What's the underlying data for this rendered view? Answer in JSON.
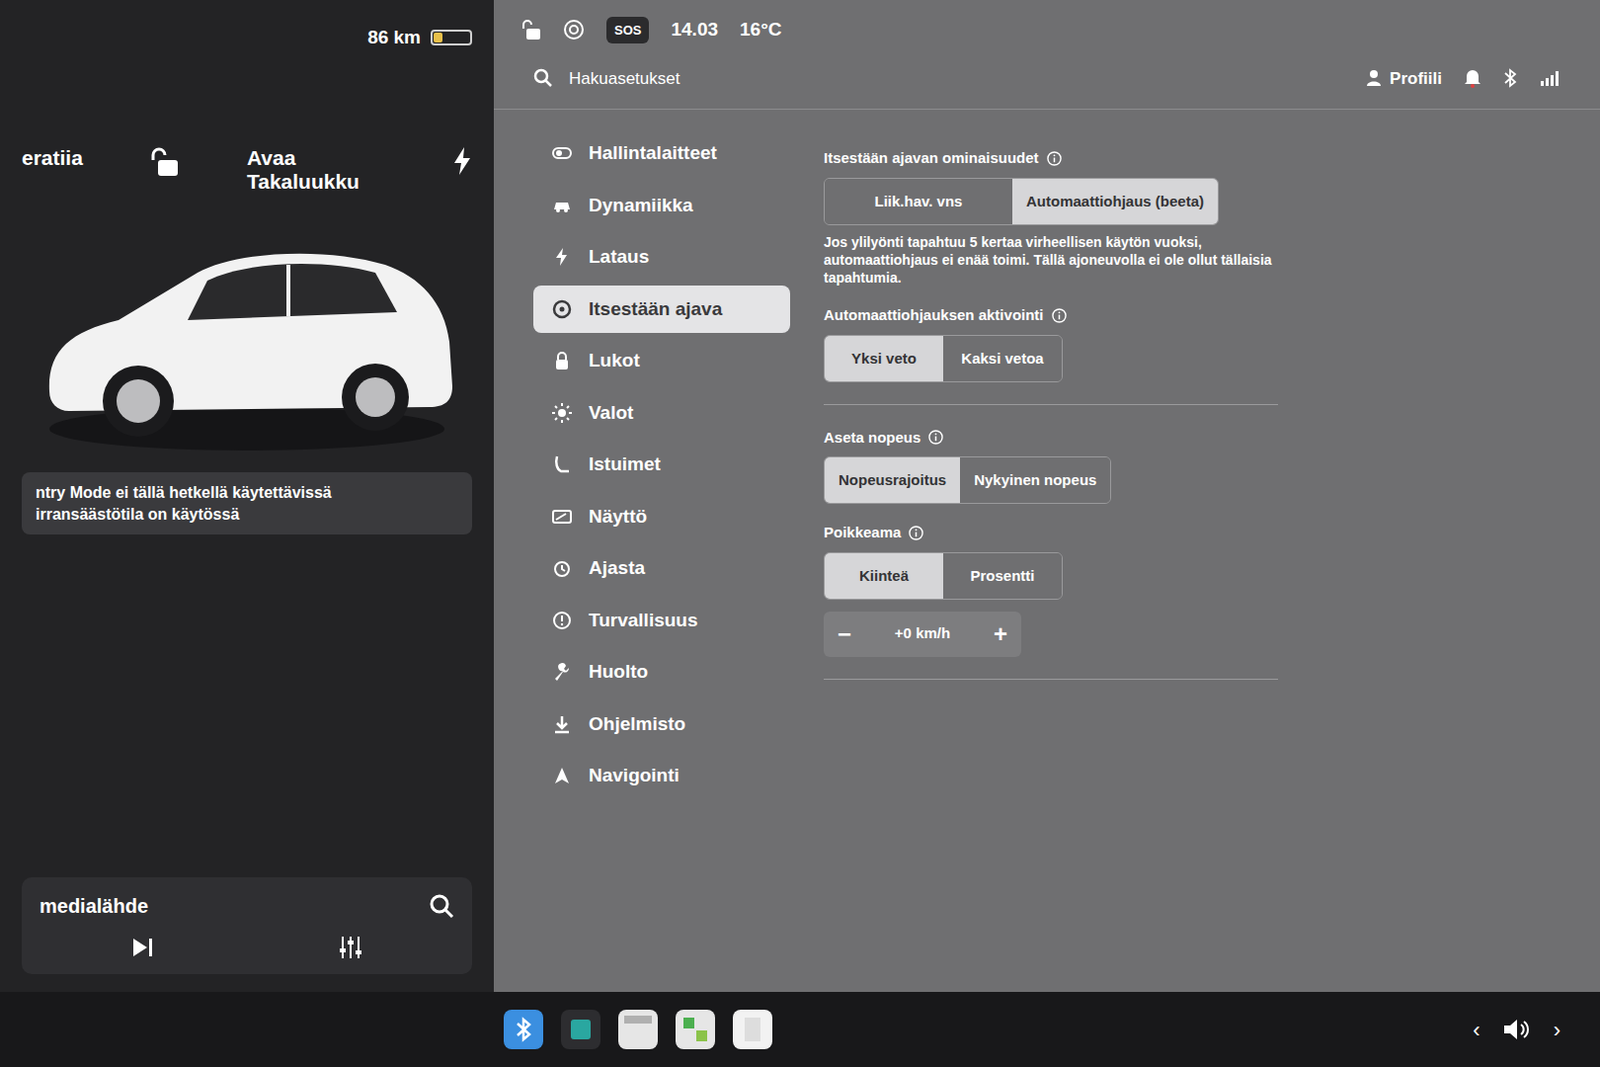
{
  "left": {
    "range": "86 km",
    "battery_level": 0.25,
    "locked": false,
    "car_labels": [
      "eratiia",
      "Avaa Takaluukku"
    ],
    "banner": [
      "ntry Mode ei tällä hetkellä käytettävissä",
      "irransäästötila on käytössä"
    ],
    "media_source": "medialähde"
  },
  "status": {
    "sos": "SOS",
    "time": "14.03",
    "temperature": "16°C"
  },
  "header": {
    "search": "Hakuasetukset",
    "profile": "Profiili"
  },
  "menu": [
    {
      "label": "Hallintalaitteet",
      "selected": false
    },
    {
      "label": "Dynamiikka",
      "selected": false
    },
    {
      "label": "Lataus",
      "selected": false
    },
    {
      "label": "Itsestään ajava",
      "selected": true
    },
    {
      "label": "Lukot",
      "selected": false
    },
    {
      "label": "Valot",
      "selected": false
    },
    {
      "label": "Istuimet",
      "selected": false
    },
    {
      "label": "Näyttö",
      "selected": false
    },
    {
      "label": "Ajasta",
      "selected": false
    },
    {
      "label": "Turvallisuus",
      "selected": false
    },
    {
      "label": "Huolto",
      "selected": false
    },
    {
      "label": "Ohjelmisto",
      "selected": false
    },
    {
      "label": "Navigointi",
      "selected": false
    }
  ],
  "sections": [
    {
      "title": "Itsestään ajavan ominaisuudet",
      "options": [
        {
          "label": "Liik.hav. vns",
          "selected": false
        },
        {
          "label": "Automaattiohjaus (beeta)",
          "selected": true
        }
      ],
      "note": "Jos ylilyönti tapahtuu 5 kertaa virheellisen käytön vuoksi, automaattiohjaus ei enää toimi. Tällä ajoneuvolla ei ole ollut tällaisia tapahtumia."
    },
    {
      "title": "Automaattiohjauksen aktivointi",
      "options": [
        {
          "label": "Yksi veto",
          "selected": true
        },
        {
          "label": "Kaksi vetoa",
          "selected": false
        }
      ]
    },
    {
      "title": "Aseta nopeus",
      "options": [
        {
          "label": "Nopeusrajoitus",
          "selected": true
        },
        {
          "label": "Nykyinen nopeus",
          "selected": false
        }
      ]
    },
    {
      "title": "Poikkeama",
      "options": [
        {
          "label": "Kiinteä",
          "selected": true
        },
        {
          "label": "Prosentti",
          "selected": false
        }
      ]
    }
  ],
  "stepper": {
    "minus": "−",
    "value": "+0 km/h",
    "plus": "+"
  },
  "taskbar": {
    "prev": "‹",
    "next": "›"
  }
}
